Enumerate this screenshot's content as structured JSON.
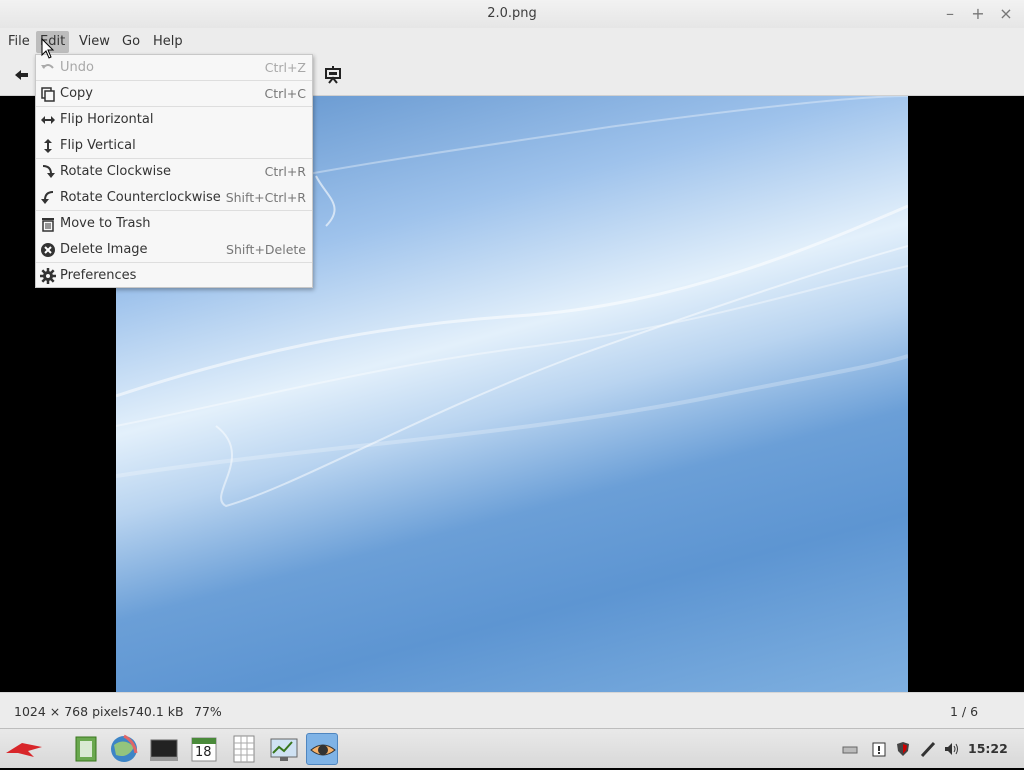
{
  "window": {
    "title": "2.0.png"
  },
  "window_controls": {
    "minimize": "–",
    "maximize": "+",
    "close": "×"
  },
  "menubar": {
    "items": [
      {
        "label": "File"
      },
      {
        "label": "Edit"
      },
      {
        "label": "View"
      },
      {
        "label": "Go"
      },
      {
        "label": "Help"
      }
    ]
  },
  "edit_menu": {
    "items": [
      {
        "label": "Undo",
        "accel": "Ctrl+Z",
        "icon": "undo-icon",
        "disabled": true
      },
      {
        "label": "Copy",
        "accel": "Ctrl+C",
        "icon": "copy-icon"
      },
      {
        "label": "Flip Horizontal",
        "accel": "",
        "icon": "flip-horizontal-icon"
      },
      {
        "label": "Flip Vertical",
        "accel": "",
        "icon": "flip-vertical-icon"
      },
      {
        "label": "Rotate Clockwise",
        "accel": "Ctrl+R",
        "icon": "rotate-clockwise-icon"
      },
      {
        "label": "Rotate Counterclockwise",
        "accel": "Shift+Ctrl+R",
        "icon": "rotate-counterclockwise-icon"
      },
      {
        "label": "Move to Trash",
        "accel": "",
        "icon": "trash-icon"
      },
      {
        "label": "Delete Image",
        "accel": "Shift+Delete",
        "icon": "delete-icon"
      },
      {
        "label": "Preferences",
        "accel": "",
        "icon": "gear-icon"
      }
    ]
  },
  "statusbar": {
    "dimensions": "1024 × 768 pixels",
    "filesize": "740.1 kB",
    "zoom": "77%",
    "position": "1 / 6"
  },
  "taskbar": {
    "calendar_day": "18",
    "clock": "15:22"
  },
  "colors": {
    "menu_active": "#bdbdbd",
    "launcher_active": "#7fb3e6"
  }
}
